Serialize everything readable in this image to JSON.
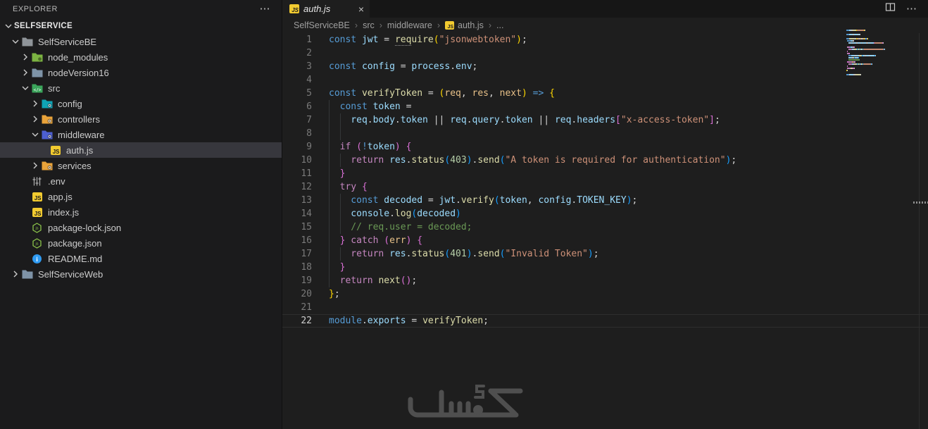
{
  "sidebar": {
    "header": {
      "title": "EXPLORER",
      "more": "⋯"
    },
    "section": {
      "label": "SELFSERVICE"
    },
    "tree": [
      {
        "label": "SelfServiceBE",
        "icon": "folder",
        "color": "#8f9499",
        "pad": 14,
        "chev": "down"
      },
      {
        "label": "node_modules",
        "icon": "folder",
        "color": "#7cb342",
        "pad": 28,
        "chev": "right",
        "badge": "dot"
      },
      {
        "label": "nodeVersion16",
        "icon": "folder",
        "color": "#7e93a7",
        "pad": 28,
        "chev": "right"
      },
      {
        "label": "src",
        "icon": "folder",
        "color": "#3ba55b",
        "pad": 28,
        "chev": "down",
        "badge": "code"
      },
      {
        "label": "config",
        "icon": "folder",
        "color": "#0fa3b5",
        "pad": 42,
        "chev": "right",
        "badge": "gear"
      },
      {
        "label": "controllers",
        "icon": "folder",
        "color": "#e9a33a",
        "pad": 42,
        "chev": "right",
        "badge": "gear"
      },
      {
        "label": "middleware",
        "icon": "folder",
        "color": "#4d5fd0",
        "pad": 42,
        "chev": "down",
        "badge": "gear"
      },
      {
        "label": "auth.js",
        "icon": "js",
        "pad": 70,
        "selected": true
      },
      {
        "label": "services",
        "icon": "folder",
        "color": "#e9a33a",
        "pad": 42,
        "chev": "right",
        "badge": "gear"
      },
      {
        "label": ".env",
        "icon": "env",
        "pad": 44
      },
      {
        "label": "app.js",
        "icon": "js",
        "pad": 44
      },
      {
        "label": "index.js",
        "icon": "js",
        "pad": 44
      },
      {
        "label": "package-lock.json",
        "icon": "json",
        "pad": 44
      },
      {
        "label": "package.json",
        "icon": "json",
        "pad": 44
      },
      {
        "label": "README.md",
        "icon": "info",
        "pad": 44
      },
      {
        "label": "SelfServiceWeb",
        "icon": "folder",
        "color": "#7e93a7",
        "pad": 14,
        "chev": "right"
      }
    ]
  },
  "tabbar": {
    "tabs": [
      {
        "label": "auth.js",
        "icon": "js",
        "close_icon": "×",
        "active": true
      }
    ],
    "actions": {
      "split_icon": "split-editor",
      "more": "⋯"
    }
  },
  "breadcrumb": {
    "sep": "›",
    "items": [
      {
        "label": "SelfServiceBE"
      },
      {
        "label": "src"
      },
      {
        "label": "middleware"
      },
      {
        "label": "auth.js",
        "icon": "js"
      },
      {
        "label": "..."
      }
    ]
  },
  "editor": {
    "active_line": 22,
    "colors": {
      "kw": "#569CD6",
      "ct": "#C586C0",
      "vr": "#9CDCFE",
      "fn": "#DCDCAA",
      "st": "#CE9178",
      "nm": "#B5CEA8",
      "cm": "#6A9955",
      "fg": "#D4D4D4",
      "pr": "#E7C088",
      "b1": "#FFD700",
      "b2": "#DA70D6",
      "b3": "#179FFF",
      "line_number": "#7a7a7a",
      "active_line_number": "#cfcfcf",
      "background": "#1e1e1e"
    },
    "lines": [
      {
        "n": 1,
        "i": 0,
        "g": [],
        "tk": [
          [
            "kw",
            "const "
          ],
          [
            "vr",
            "jwt"
          ],
          [
            "fg",
            " = "
          ],
          [
            "fn u",
            "req"
          ],
          [
            "fn",
            "uire"
          ],
          [
            "b1",
            "("
          ],
          [
            "st",
            "\"jsonwebtoken\""
          ],
          [
            "b1",
            ")"
          ],
          [
            "fg",
            ";"
          ]
        ]
      },
      {
        "n": 2,
        "i": 0,
        "g": [],
        "tk": []
      },
      {
        "n": 3,
        "i": 0,
        "g": [],
        "tk": [
          [
            "kw",
            "const "
          ],
          [
            "vr",
            "config"
          ],
          [
            "fg",
            " = "
          ],
          [
            "vr",
            "process"
          ],
          [
            "fg",
            "."
          ],
          [
            "vr",
            "env"
          ],
          [
            "fg",
            ";"
          ]
        ]
      },
      {
        "n": 4,
        "i": 0,
        "g": [],
        "tk": []
      },
      {
        "n": 5,
        "i": 0,
        "g": [],
        "tk": [
          [
            "kw",
            "const "
          ],
          [
            "fn",
            "verifyToken"
          ],
          [
            "fg",
            " = "
          ],
          [
            "b1",
            "("
          ],
          [
            "pr",
            "req"
          ],
          [
            "fg",
            ", "
          ],
          [
            "pr",
            "res"
          ],
          [
            "fg",
            ", "
          ],
          [
            "pr",
            "next"
          ],
          [
            "b1",
            ")"
          ],
          [
            "fg",
            " "
          ],
          [
            "kw",
            "=>"
          ],
          [
            "fg",
            " "
          ],
          [
            "b1",
            "{"
          ]
        ]
      },
      {
        "n": 6,
        "i": 1,
        "g": [
          0
        ],
        "tk": [
          [
            "kw",
            "const "
          ],
          [
            "vr",
            "token"
          ],
          [
            "fg",
            " ="
          ]
        ]
      },
      {
        "n": 7,
        "i": 2,
        "g": [
          0,
          2
        ],
        "tk": [
          [
            "vr",
            "req"
          ],
          [
            "fg",
            "."
          ],
          [
            "vr",
            "body"
          ],
          [
            "fg",
            "."
          ],
          [
            "vr",
            "token"
          ],
          [
            "fg",
            " || "
          ],
          [
            "vr",
            "req"
          ],
          [
            "fg",
            "."
          ],
          [
            "vr",
            "query"
          ],
          [
            "fg",
            "."
          ],
          [
            "vr",
            "token"
          ],
          [
            "fg",
            " || "
          ],
          [
            "vr",
            "req"
          ],
          [
            "fg",
            "."
          ],
          [
            "vr",
            "headers"
          ],
          [
            "b2",
            "["
          ],
          [
            "st",
            "\"x-access-token\""
          ],
          [
            "b2",
            "]"
          ],
          [
            "fg",
            ";"
          ]
        ]
      },
      {
        "n": 8,
        "i": 0,
        "g": [
          0,
          2
        ],
        "tk": []
      },
      {
        "n": 9,
        "i": 1,
        "g": [
          0
        ],
        "tk": [
          [
            "ct",
            "if "
          ],
          [
            "b2",
            "("
          ],
          [
            "kw",
            "!"
          ],
          [
            "vr",
            "token"
          ],
          [
            "b2",
            ")"
          ],
          [
            "fg",
            " "
          ],
          [
            "b2",
            "{"
          ]
        ]
      },
      {
        "n": 10,
        "i": 2,
        "g": [
          0,
          2
        ],
        "tk": [
          [
            "ct",
            "return "
          ],
          [
            "vr",
            "res"
          ],
          [
            "fg",
            "."
          ],
          [
            "fn",
            "status"
          ],
          [
            "b3",
            "("
          ],
          [
            "nm",
            "403"
          ],
          [
            "b3",
            ")"
          ],
          [
            "fg",
            "."
          ],
          [
            "fn",
            "send"
          ],
          [
            "b3",
            "("
          ],
          [
            "st",
            "\"A token is required for authentication\""
          ],
          [
            "b3",
            ")"
          ],
          [
            "fg",
            ";"
          ]
        ]
      },
      {
        "n": 11,
        "i": 1,
        "g": [
          0
        ],
        "tk": [
          [
            "b2",
            "}"
          ]
        ]
      },
      {
        "n": 12,
        "i": 1,
        "g": [
          0
        ],
        "tk": [
          [
            "ct",
            "try "
          ],
          [
            "b2",
            "{"
          ]
        ]
      },
      {
        "n": 13,
        "i": 2,
        "g": [
          0,
          2
        ],
        "tk": [
          [
            "kw",
            "const "
          ],
          [
            "vr",
            "decoded"
          ],
          [
            "fg",
            " = "
          ],
          [
            "vr",
            "jwt"
          ],
          [
            "fg",
            "."
          ],
          [
            "fn",
            "verify"
          ],
          [
            "b3",
            "("
          ],
          [
            "vr",
            "token"
          ],
          [
            "fg",
            ", "
          ],
          [
            "vr",
            "config"
          ],
          [
            "fg",
            "."
          ],
          [
            "vr",
            "TOKEN_KEY"
          ],
          [
            "b3",
            ")"
          ],
          [
            "fg",
            ";"
          ]
        ]
      },
      {
        "n": 14,
        "i": 2,
        "g": [
          0,
          2
        ],
        "tk": [
          [
            "vr",
            "console"
          ],
          [
            "fg",
            "."
          ],
          [
            "fn",
            "log"
          ],
          [
            "b3",
            "("
          ],
          [
            "vr",
            "decoded"
          ],
          [
            "b3",
            ")"
          ]
        ]
      },
      {
        "n": 15,
        "i": 2,
        "g": [
          0,
          2
        ],
        "tk": [
          [
            "cm",
            "// req.user = decoded;"
          ]
        ]
      },
      {
        "n": 16,
        "i": 1,
        "g": [
          0
        ],
        "tk": [
          [
            "b2",
            "} "
          ],
          [
            "ct",
            "catch "
          ],
          [
            "b2",
            "("
          ],
          [
            "pr",
            "err"
          ],
          [
            "b2",
            ")"
          ],
          [
            "fg",
            " "
          ],
          [
            "b2",
            "{"
          ]
        ]
      },
      {
        "n": 17,
        "i": 2,
        "g": [
          0,
          2
        ],
        "tk": [
          [
            "ct",
            "return "
          ],
          [
            "vr",
            "res"
          ],
          [
            "fg",
            "."
          ],
          [
            "fn",
            "status"
          ],
          [
            "b3",
            "("
          ],
          [
            "nm",
            "401"
          ],
          [
            "b3",
            ")"
          ],
          [
            "fg",
            "."
          ],
          [
            "fn",
            "send"
          ],
          [
            "b3",
            "("
          ],
          [
            "st",
            "\"Invalid Token\""
          ],
          [
            "b3",
            ")"
          ],
          [
            "fg",
            ";"
          ]
        ]
      },
      {
        "n": 18,
        "i": 1,
        "g": [
          0
        ],
        "tk": [
          [
            "b2",
            "}"
          ]
        ]
      },
      {
        "n": 19,
        "i": 1,
        "g": [
          0
        ],
        "tk": [
          [
            "ct",
            "return "
          ],
          [
            "fn",
            "next"
          ],
          [
            "b2",
            "()"
          ],
          [
            "fg",
            ";"
          ]
        ]
      },
      {
        "n": 20,
        "i": 0,
        "g": [],
        "tk": [
          [
            "b1",
            "}"
          ],
          [
            "fg",
            ";"
          ]
        ]
      },
      {
        "n": 21,
        "i": 0,
        "g": [],
        "tk": []
      },
      {
        "n": 22,
        "i": 0,
        "g": [],
        "tk": [
          [
            "kw",
            "module"
          ],
          [
            "fg",
            "."
          ],
          [
            "vr",
            "exports"
          ],
          [
            "fg",
            " = "
          ],
          [
            "fn",
            "verifyToken"
          ],
          [
            "fg",
            ";"
          ]
        ]
      }
    ]
  },
  "watermark": {
    "text": "خمسات"
  }
}
